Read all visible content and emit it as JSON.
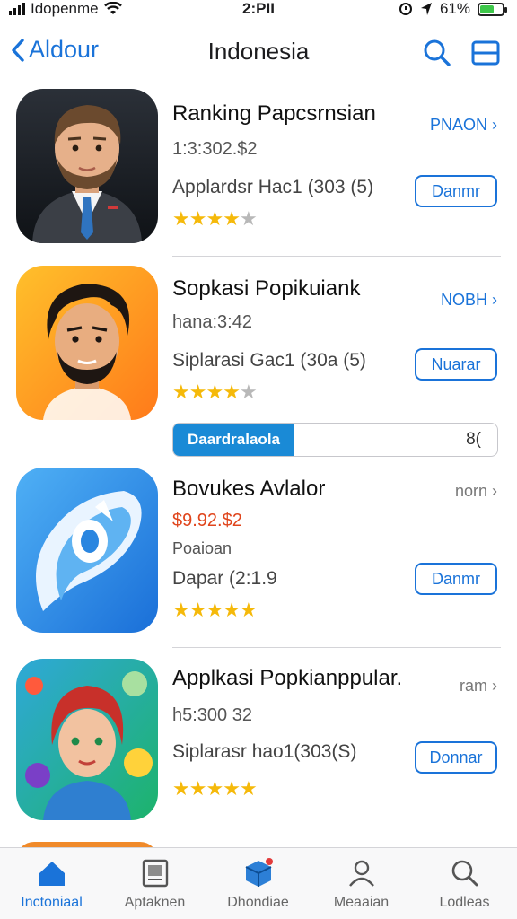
{
  "status_bar": {
    "carrier": "Idopenme",
    "time": "2:PII",
    "battery": "61%",
    "battery_level": 0.61
  },
  "nav": {
    "back_label": "Aldour",
    "title": "Indonesia"
  },
  "apps": [
    {
      "name": "Ranking Papcsrnsian",
      "price": "1:3:302.$2",
      "meta": "Applardsr Hac1 (303 (5)",
      "rating": 3.5,
      "chip": "PNAON",
      "button": "Danmr"
    },
    {
      "name": "Sopkasi Popikuiank",
      "price": "hana:3:42",
      "meta": "Siplarasi Gac1 (30a (5)",
      "rating": 3.5,
      "chip": "NOBH",
      "button": "Nuarar"
    },
    {
      "name": "Bovukes Avlalor",
      "price": "$9.92.$2",
      "meta": "Dapar (2:1.9",
      "rating": 4.5,
      "chip": "norn",
      "button": "Danmr",
      "sub": "Poaioan"
    },
    {
      "name": "Applkasi Popkianppular.",
      "price": "h5:300 32",
      "meta": "Siplarasr hao1(303(S)",
      "rating": 4.5,
      "chip": "ram",
      "button": "Donnar"
    }
  ],
  "progress": {
    "label": "Daardralaola",
    "percent_label": "8(",
    "fraction": 0.37
  },
  "tabs": [
    {
      "label": "Inctoniaal",
      "icon": "home-icon",
      "active": true
    },
    {
      "label": "Aptaknen",
      "icon": "reader-icon",
      "active": false
    },
    {
      "label": "Dhondiae",
      "icon": "cube-icon",
      "active": false
    },
    {
      "label": "Meaaian",
      "icon": "person-icon",
      "active": false
    },
    {
      "label": "Lodleas",
      "icon": "search-icon",
      "active": false
    }
  ],
  "colors": {
    "accent": "#1a73d9",
    "star": "#f5b90a",
    "progress": "#1a8ad6",
    "battery": "#3ec74a"
  }
}
